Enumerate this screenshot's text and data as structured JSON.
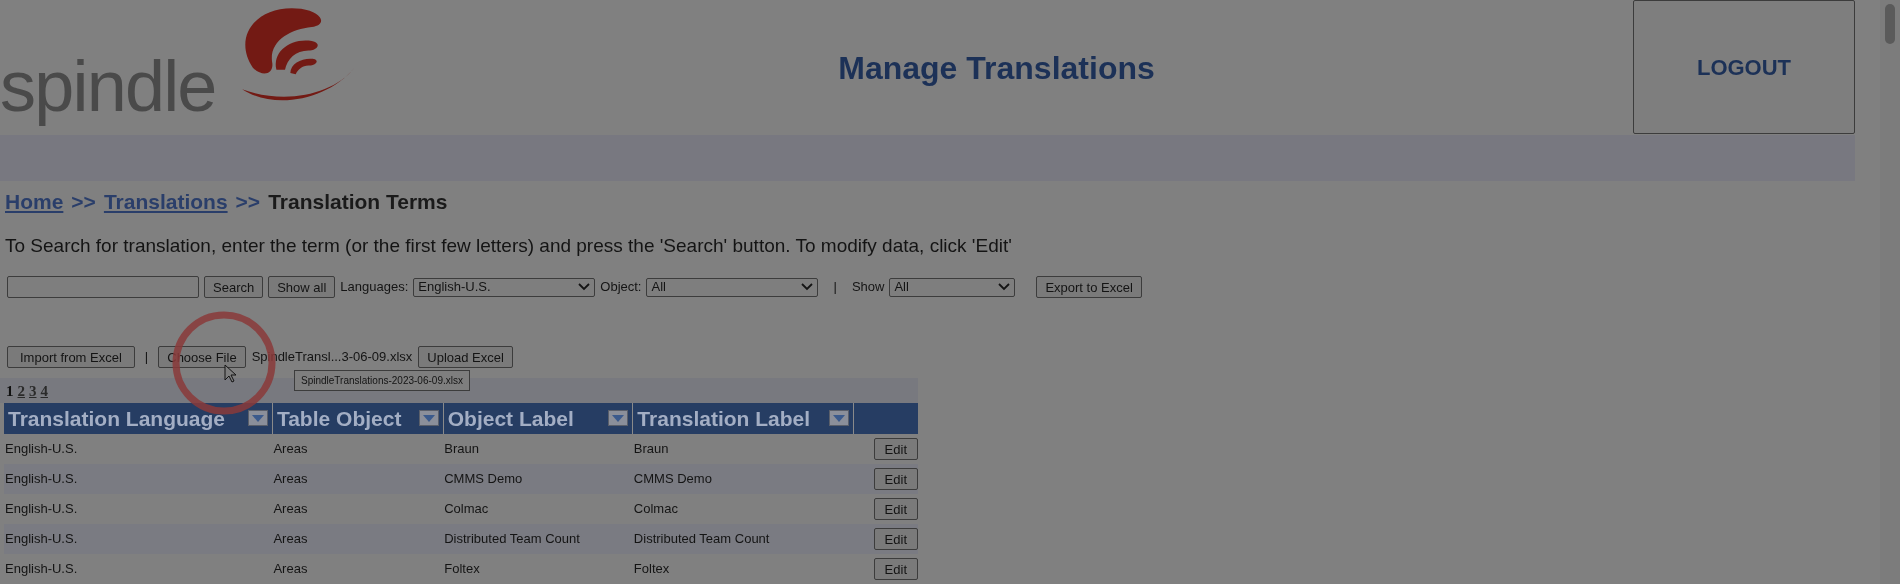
{
  "header": {
    "logo_text": "spindle",
    "title": "Manage Translations",
    "logout_button": "LOGOUT"
  },
  "breadcrumb": [
    {
      "label": "Home",
      "kind": "link"
    },
    {
      "label": ">>",
      "kind": "separator"
    },
    {
      "label": "Translations",
      "kind": "link"
    },
    {
      "label": ">>",
      "kind": "separator"
    },
    {
      "label": "Translation Terms",
      "kind": "current"
    }
  ],
  "instructions": "To Search for translation, enter the term (or the first few letters) and press the 'Search' button. To modify data, click 'Edit'",
  "search": {
    "search_button": "Search",
    "show_all_button": "Show all",
    "languages_label": "Languages:",
    "languages_value": "English-U.S.",
    "object_label": "Object:",
    "object_value": "All",
    "separator": "|",
    "show_label": "Show",
    "show_value": "All",
    "export_button": "Export to Excel"
  },
  "import": {
    "import_button": "Import from Excel",
    "separator": "|",
    "choose_file_button": "Choose File",
    "file_name": "SpindleTransl...3-06-09.xlsx",
    "upload_button": "Upload Excel",
    "tooltip": "SpindleTranslations-2023-06-09.xlsx"
  },
  "pagination": [
    {
      "label": "1",
      "selected": true
    },
    {
      "label": "2",
      "selected": false
    },
    {
      "label": "3",
      "selected": false
    },
    {
      "label": "4",
      "selected": false
    }
  ],
  "table": {
    "columns": [
      "Translation Language",
      "Table Object",
      "Object Label",
      "Translation Label"
    ],
    "rows": [
      {
        "cells": [
          "English-U.S.",
          "Areas",
          "Braun",
          "Braun"
        ],
        "action": "Edit"
      },
      {
        "cells": [
          "English-U.S.",
          "Areas",
          "CMMS Demo",
          "CMMS Demo"
        ],
        "action": "Edit"
      },
      {
        "cells": [
          "English-U.S.",
          "Areas",
          "Colmac",
          "Colmac"
        ],
        "action": "Edit"
      },
      {
        "cells": [
          "English-U.S.",
          "Areas",
          "Distributed Team Count",
          "Distributed Team Count"
        ],
        "action": "Edit"
      },
      {
        "cells": [
          "English-U.S.",
          "Areas",
          "Foltex",
          "Foltex"
        ],
        "action": "Edit"
      }
    ]
  }
}
